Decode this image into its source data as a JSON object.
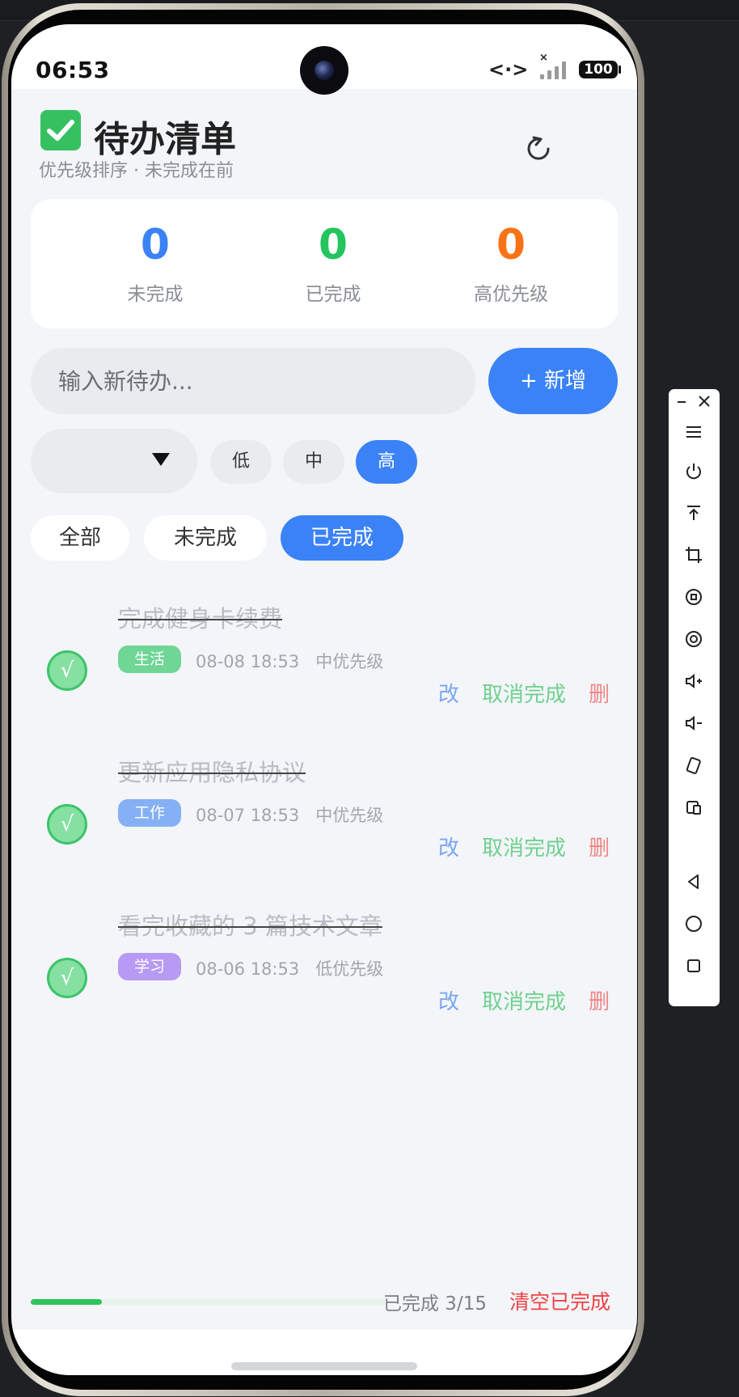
{
  "status_bar": {
    "time": "06:53",
    "network": "<·>",
    "signal_x": "×",
    "battery": "100"
  },
  "header": {
    "title": "待办清单",
    "subtitle": "优先级排序 · 未完成在前"
  },
  "stats": [
    {
      "value": "0",
      "label": "未完成",
      "color": "#3b82f6"
    },
    {
      "value": "0",
      "label": "已完成",
      "color": "#22c55e"
    },
    {
      "value": "0",
      "label": "高优先级",
      "color": "#f97316"
    }
  ],
  "new_task": {
    "placeholder": "输入新待办...",
    "add_label": "+ 新增"
  },
  "priority": {
    "options": [
      "低",
      "中",
      "高"
    ],
    "selected": "高"
  },
  "filters": {
    "tabs": [
      "全部",
      "未完成",
      "已完成"
    ],
    "selected": "已完成"
  },
  "tasks": [
    {
      "title": "完成健身卡续费",
      "tag": "生活",
      "tag_color": "#6fd695",
      "time": "08-08 18:53",
      "priority": "中优先级",
      "edit": "改",
      "undo": "取消完成",
      "delete": "删",
      "check": "√"
    },
    {
      "title": "更新应用隐私协议",
      "tag": "工作",
      "tag_color": "#86b0f5",
      "time": "08-07 18:53",
      "priority": "中优先级",
      "edit": "改",
      "undo": "取消完成",
      "delete": "删",
      "check": "√"
    },
    {
      "title": "看完收藏的 3 篇技术文章",
      "tag": "学习",
      "tag_color": "#b79af4",
      "time": "08-06 18:53",
      "priority": "低优先级",
      "edit": "改",
      "undo": "取消完成",
      "delete": "删",
      "check": "√"
    }
  ],
  "footer": {
    "progress_text": "已完成 3/15",
    "progress_fraction": 0.2,
    "clear_label": "清空已完成"
  },
  "icons": {
    "app_icon": "check-square-icon",
    "refresh": "refresh-icon",
    "toolbar": [
      "minimize-icon",
      "close-icon",
      "menu-icon",
      "power-icon",
      "pin-top-icon",
      "crop-icon",
      "screen-record-icon",
      "screenshot-icon",
      "volume-up-icon",
      "volume-down-icon",
      "rotate-icon",
      "device-icon",
      "back-icon",
      "home-icon",
      "recents-icon"
    ]
  }
}
